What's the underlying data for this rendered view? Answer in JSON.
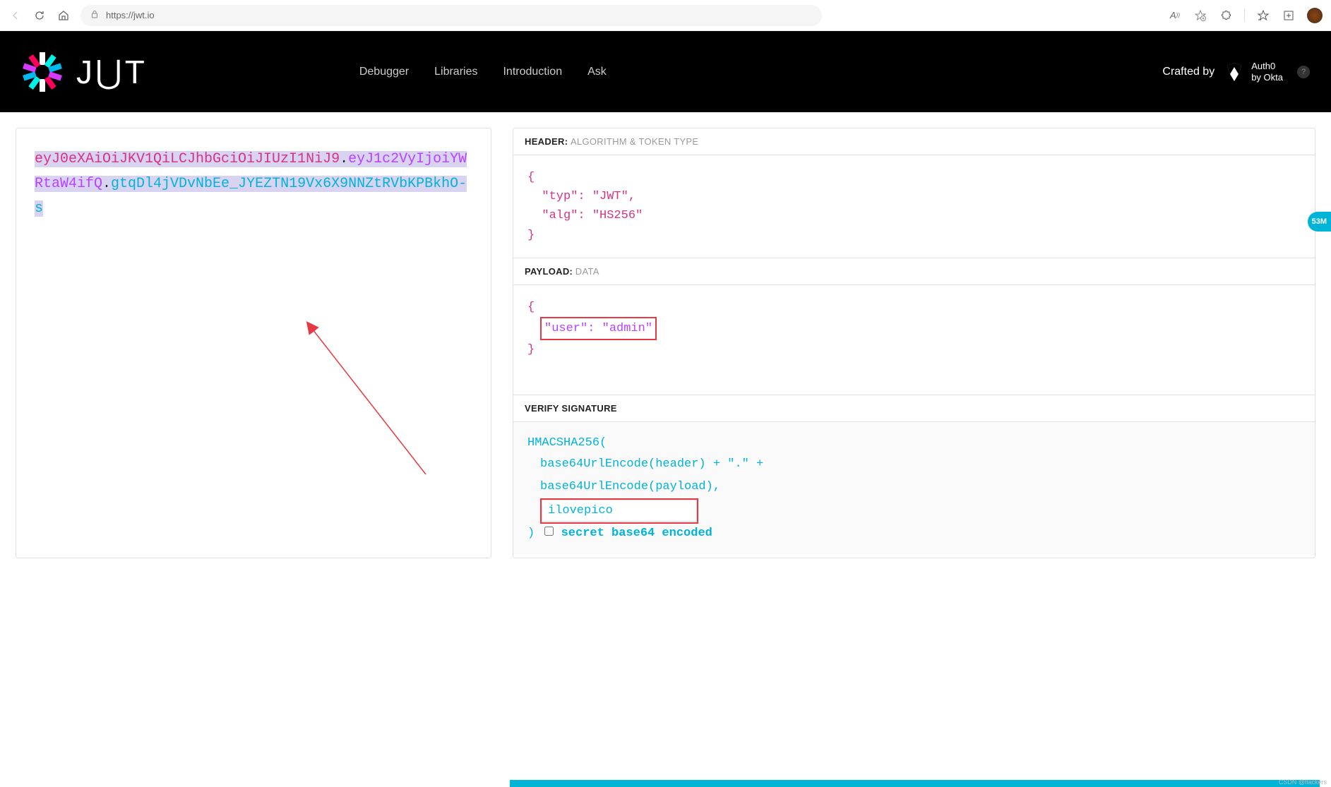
{
  "browser": {
    "url": "https://jwt.io"
  },
  "nav": {
    "links": [
      "Debugger",
      "Libraries",
      "Introduction",
      "Ask"
    ],
    "crafted": "Crafted by",
    "auth0_line1": "Auth0",
    "auth0_line2": "by Okta"
  },
  "token": {
    "header": "eyJ0eXAiOiJKV1QiLCJhbGciOiJIUzI1NiJ9",
    "payload": "eyJ1c2VyIjoiYWRtaW4ifQ",
    "signature": "gtqDl4jVDvNbEe_JYEZTN19Vx6X9NNZtRVbKPBkhO-s",
    "dot": "."
  },
  "decoded": {
    "header_label": "HEADER:",
    "header_sub": "ALGORITHM & TOKEN TYPE",
    "header_json": "{\n  \"typ\": \"JWT\",\n  \"alg\": \"HS256\"\n}",
    "payload_label": "PAYLOAD:",
    "payload_sub": "DATA",
    "payload_open": "{",
    "payload_content": "\"user\": \"admin\"",
    "payload_close": "}",
    "sig_label": "VERIFY SIGNATURE",
    "sig_fn": "HMACSHA256(",
    "sig_l1": "base64UrlEncode(header) + \".\" +",
    "sig_l2": "base64UrlEncode(payload),",
    "sig_close": ")",
    "secret_value": "ilovepico",
    "secret_label": "secret base64 encoded"
  },
  "badge": "53M",
  "watermark": "CSDN @flackers"
}
